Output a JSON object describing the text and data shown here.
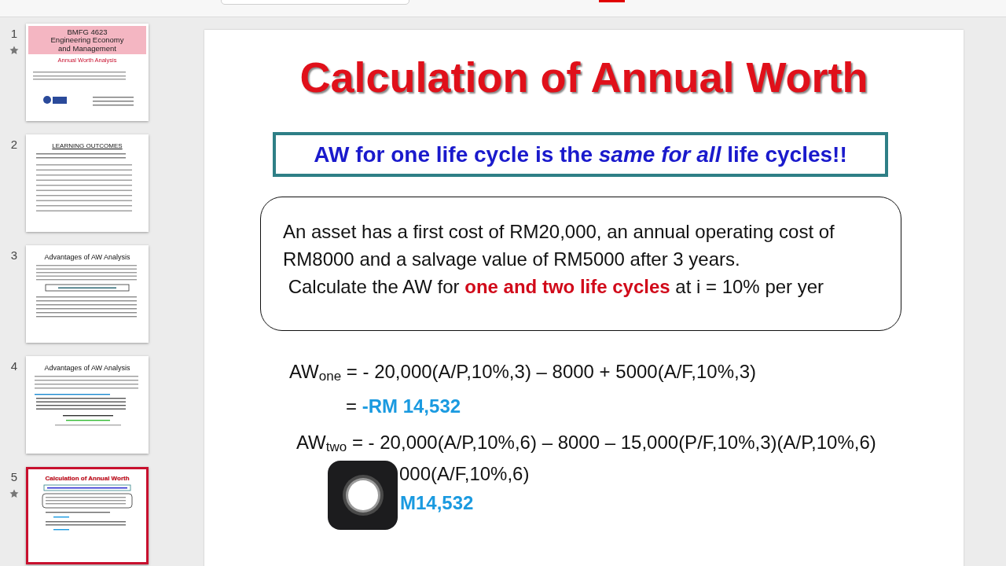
{
  "thumbnails": [
    {
      "number": "1",
      "starred": true,
      "selected": false,
      "kind": "title",
      "banner": [
        "BMFG 4623",
        "Engineering Economy",
        "and Management"
      ],
      "subtitle": "Annual Worth Analysis"
    },
    {
      "number": "2",
      "starred": false,
      "selected": false,
      "kind": "list",
      "title": "LEARNING OUTCOMES"
    },
    {
      "number": "3",
      "starred": false,
      "selected": false,
      "kind": "boxed",
      "title": "Advantages of AW Analysis"
    },
    {
      "number": "4",
      "starred": false,
      "selected": false,
      "kind": "terms",
      "title": "Advantages of AW Analysis"
    },
    {
      "number": "5",
      "starred": true,
      "selected": true,
      "kind": "calc",
      "title": "Calculation of Annual Worth"
    }
  ],
  "slide": {
    "title": "Calculation of Annual Worth",
    "callout": "AW for one life cycle is the *same for all* life cycles!!",
    "problem": [
      "An asset has a first cost of RM20,000, an annual operating cost of",
      "RM8000 and a salvage value of RM5000 after 3 years.",
      " Calculate the AW for **one and two life cycles** at i = 10% per yer"
    ],
    "equations": [
      {
        "kind": "equation",
        "text": "AW$_{one}$ = - 20,000(A/P,10%,3) – 8000 + 5000(A/F,10%,3)"
      },
      {
        "kind": "result",
        "text": "= **-RM 14,532**"
      },
      {
        "kind": "equation",
        "text": "AW$_{two}$ = - 20,000(A/P,10%,6) – 8000 – 15,000(P/F,10%,3)(A/P,10%,6)"
      },
      {
        "kind": "continuation",
        "text": "000(A/F,10%,6)"
      },
      {
        "kind": "continuation",
        "text": "**M14,532**"
      }
    ]
  }
}
